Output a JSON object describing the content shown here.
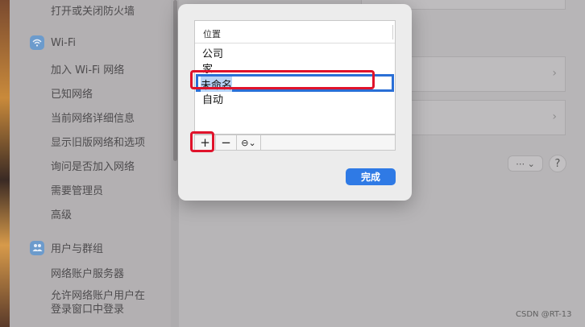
{
  "sidebar": {
    "firewall_toggle": "打开或关闭防火墙",
    "wifi_section": "Wi-Fi",
    "wifi_items": [
      "加入 Wi-Fi 网络",
      "已知网络",
      "当前网络详细信息",
      "显示旧版网络和选项",
      "询问是否加入网络",
      "需要管理员",
      "高级"
    ],
    "users_section": "用户与群组",
    "users_items": [
      "网络账户服务器",
      "允许网络账户用户在",
      "登录窗口中登录"
    ]
  },
  "main": {
    "more_button": "⋯ ⌄",
    "help_button": "?"
  },
  "dialog": {
    "column_header": "位置",
    "locations": [
      "公司",
      "家"
    ],
    "editing_value": "未命名",
    "locations_after": [
      "自动"
    ],
    "add_button": "+",
    "remove_button": "−",
    "action_menu": "⊖⌄",
    "done_button": "完成"
  },
  "watermark": "CSDN @RT-13",
  "colors": {
    "accent": "#2f7ae5",
    "annotation": "#e0132b"
  }
}
